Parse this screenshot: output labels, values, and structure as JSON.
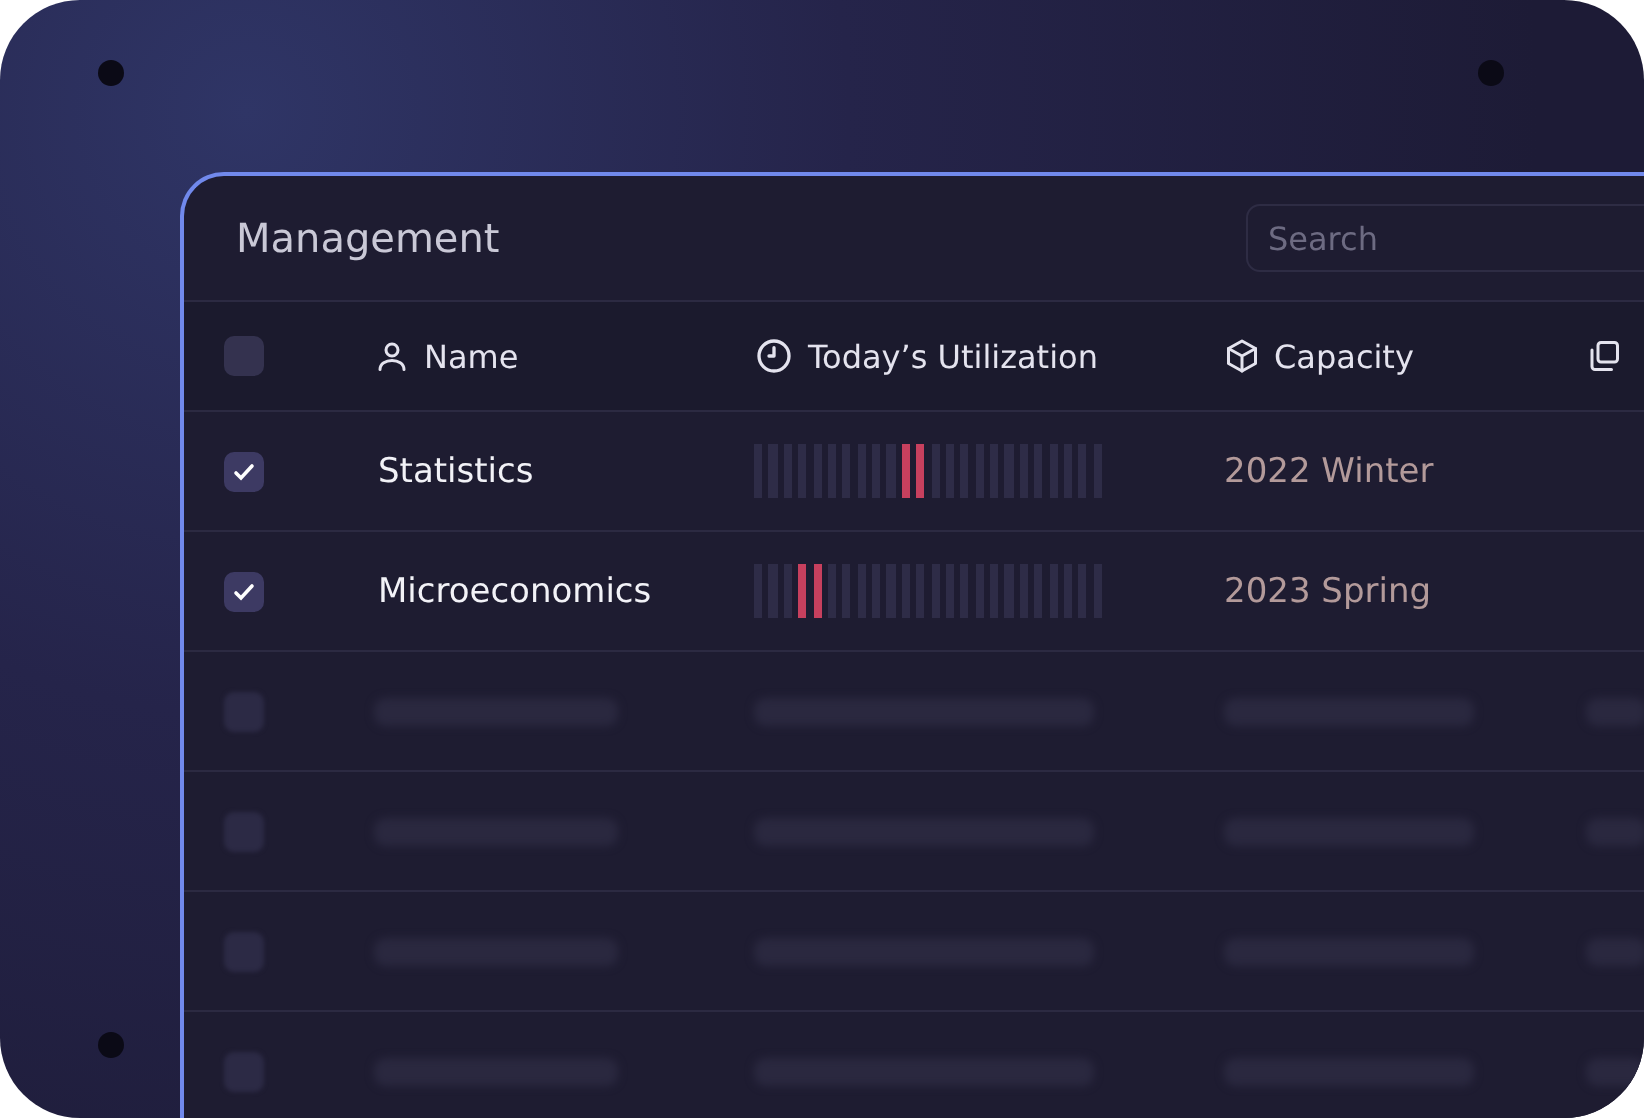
{
  "panel": {
    "title": "Management",
    "search": {
      "placeholder": "Search"
    }
  },
  "table": {
    "header": {
      "checked": false
    },
    "columns": [
      {
        "label": "Name",
        "kind": "user"
      },
      {
        "label": "Today’s Utilization",
        "kind": "clock"
      },
      {
        "label": "Capacity",
        "kind": "cube"
      },
      {
        "kind": "copy"
      }
    ],
    "rows": [
      {
        "checked": true,
        "name": "Statistics",
        "capacity": "2022 Winter",
        "segments": [
          {
            "hot": false
          },
          {
            "hot": false
          },
          {
            "hot": false
          },
          {
            "hot": false
          },
          {
            "hot": false
          },
          {
            "hot": false
          },
          {
            "hot": false
          },
          {
            "hot": false
          },
          {
            "hot": false
          },
          {
            "hot": false
          },
          {
            "hot": true
          },
          {
            "hot": true
          },
          {
            "hot": false
          },
          {
            "hot": false
          },
          {
            "hot": false
          },
          {
            "hot": false
          },
          {
            "hot": false
          },
          {
            "hot": false
          },
          {
            "hot": false
          },
          {
            "hot": false
          },
          {
            "hot": false
          },
          {
            "hot": false
          },
          {
            "hot": false
          },
          {
            "hot": false
          }
        ]
      },
      {
        "checked": true,
        "name": "Microeconomics",
        "capacity": "2023 Spring",
        "segments": [
          {
            "hot": false
          },
          {
            "hot": false
          },
          {
            "hot": false
          },
          {
            "hot": true
          },
          {
            "hot": true
          },
          {
            "hot": false
          },
          {
            "hot": false
          },
          {
            "hot": false
          },
          {
            "hot": false
          },
          {
            "hot": false
          },
          {
            "hot": false
          },
          {
            "hot": false
          },
          {
            "hot": false
          },
          {
            "hot": false
          },
          {
            "hot": false
          },
          {
            "hot": false
          },
          {
            "hot": false
          },
          {
            "hot": false
          },
          {
            "hot": false
          },
          {
            "hot": false
          },
          {
            "hot": false
          },
          {
            "hot": false
          },
          {
            "hot": false
          },
          {
            "hot": false
          }
        ]
      }
    ],
    "skeleton_rows": [
      {
        "kind": "skeleton",
        "checked": false
      },
      {
        "kind": "skeleton",
        "checked": false
      },
      {
        "kind": "skeleton",
        "checked": false
      },
      {
        "kind": "skeleton",
        "checked": false
      }
    ]
  }
}
